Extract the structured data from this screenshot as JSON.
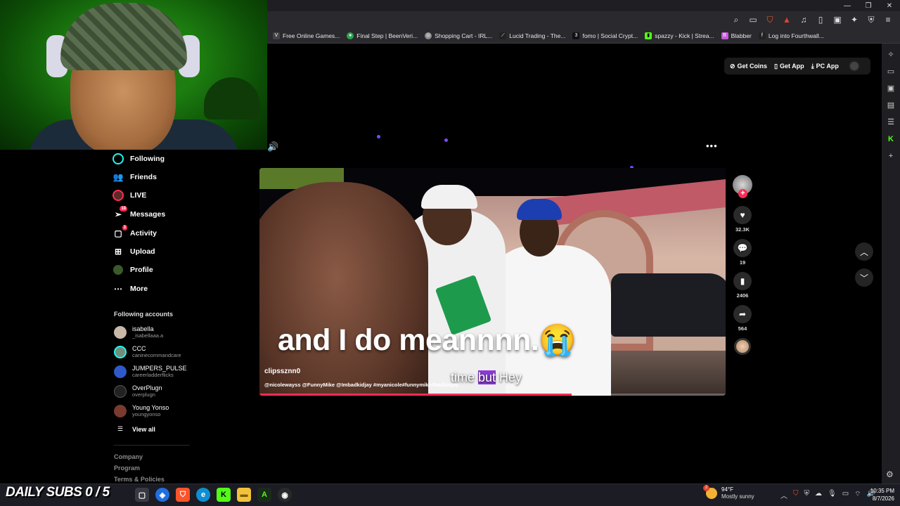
{
  "window_controls": {
    "minimize": "—",
    "restore": "❐",
    "close": "✕"
  },
  "bookmarks": [
    {
      "label": "Free Online Games...",
      "icon": "vk-icon",
      "color": "#444444",
      "glyph": "V"
    },
    {
      "label": "Final Step | BeenVeri...",
      "icon": "globe-icon",
      "color": "#2da44e",
      "glyph": "●"
    },
    {
      "label": "Shopping Cart - IRL...",
      "icon": "globe-icon",
      "color": "#8a8a8a",
      "glyph": "◎"
    },
    {
      "label": "Lucid Trading - The...",
      "icon": "lucid-icon",
      "color": "#222222",
      "glyph": "⟋"
    },
    {
      "label": "fomo | Social Crypt...",
      "icon": "fomo-icon",
      "color": "#111111",
      "glyph": "3"
    },
    {
      "label": "spazzy - Kick | Strea...",
      "icon": "kick-icon",
      "color": "#53fc18",
      "glyph": "▮"
    },
    {
      "label": "Blabber",
      "icon": "blabber-icon",
      "color": "#c45bd6",
      "glyph": "B"
    },
    {
      "label": "Log into Fourthwall...",
      "icon": "fourthwall-icon",
      "color": "#222222",
      "glyph": "fw"
    }
  ],
  "top_buttons": {
    "get_coins": "Get Coins",
    "get_app": "Get App",
    "pc_app": "PC App"
  },
  "nav": {
    "following": "Following",
    "friends": "Friends",
    "live": "LIVE",
    "messages": "Messages",
    "messages_badge": "18",
    "activity": "Activity",
    "activity_badge": "3",
    "upload": "Upload",
    "profile": "Profile",
    "more": "More"
  },
  "following_accounts": {
    "title": "Following accounts",
    "items": [
      {
        "name": "isabella",
        "handle": "_isabellaaa.a",
        "color": "#c9b7a8"
      },
      {
        "name": "CCC",
        "handle": "caninecommandcare",
        "color": "#6f8f7a"
      },
      {
        "name": "JUMPERS_PULSE",
        "handle": "careerladderflicks",
        "color": "#2f58c9"
      },
      {
        "name": "OverPlugn",
        "handle": "overplugn",
        "color": "#222222"
      },
      {
        "name": "Young Yonso",
        "handle": "youngyonso",
        "color": "#7a3b2e"
      }
    ],
    "view_all": "View all"
  },
  "footer": {
    "company": "Company",
    "program": "Program",
    "terms": "Terms & Policies"
  },
  "video": {
    "caption": "and I do meannnn.😭",
    "subtitle_before": "time ",
    "subtitle_highlight": "but",
    "subtitle_after": " Hey",
    "author": "clipssznn0",
    "hashtags": "@nicolewayss @FunnyMike @Imbadkidjay #myanicole#funnymike#badkidjay",
    "progress": 0.67
  },
  "actions": {
    "likes": "32.3K",
    "comments": "19",
    "saves": "2406",
    "shares": "564"
  },
  "taskbar": {
    "subs_overlay": "DAILY SUBS 0 / 5",
    "weather_temp": "94°F",
    "weather_cond": "Mostly sunny",
    "weather_badge": "2",
    "time": "10:35 PM",
    "date": "8/7/2026"
  },
  "colors": {
    "accent": "#fe2c55",
    "kick": "#53fc18",
    "highlight": "#8b3ad6"
  }
}
